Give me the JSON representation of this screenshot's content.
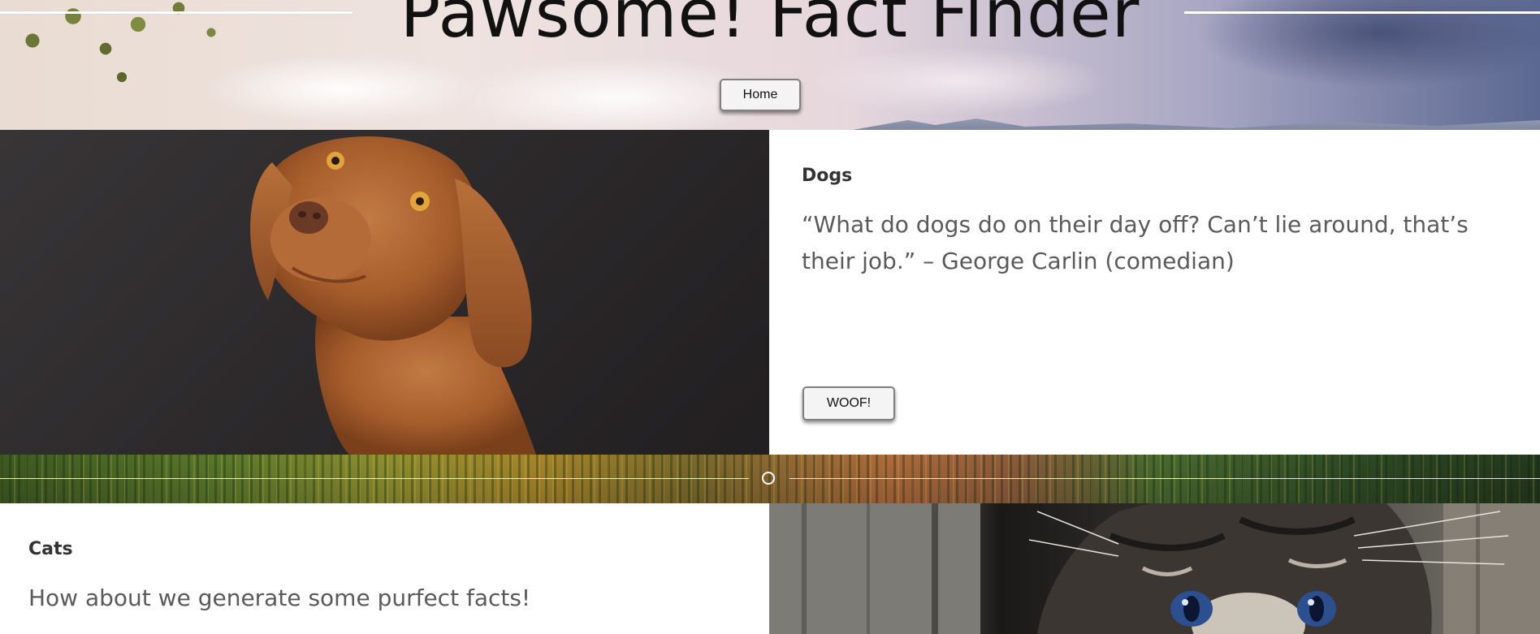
{
  "header": {
    "title": "Pawsome! Fact Finder",
    "home_button": "Home"
  },
  "dogs": {
    "title": "Dogs",
    "quote": "“What do dogs do on their day off? Can’t lie around, that’s their job.” – George Carlin (comedian)",
    "button": "WOOF!",
    "image": "dog-photo"
  },
  "cats": {
    "title": "Cats",
    "text": "How about we generate some purfect facts!",
    "image": "kitten-photo"
  }
}
